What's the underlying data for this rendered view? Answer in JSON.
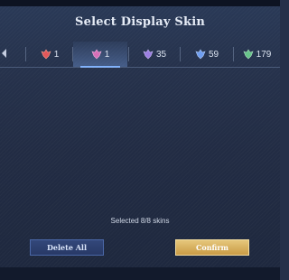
{
  "title": "Select Display Skin",
  "tabs": [
    {
      "count": "1",
      "icon": "red-rank-emblem-icon",
      "color": "#e3575a",
      "selected": false
    },
    {
      "count": "1",
      "icon": "pink-rank-emblem-icon",
      "color": "#d76fb8",
      "selected": true
    },
    {
      "count": "35",
      "icon": "purple-rank-emblem-icon",
      "color": "#9b7fe2",
      "selected": false
    },
    {
      "count": "59",
      "icon": "blue-rank-emblem-icon",
      "color": "#6f9ef0",
      "selected": false
    },
    {
      "count": "179",
      "icon": "green-rank-emblem-icon",
      "color": "#67c58a",
      "selected": false
    }
  ],
  "status": "Selected 8/8 skins",
  "buttons": {
    "delete_all": "Delete All",
    "confirm": "Confirm"
  },
  "colors": {
    "confirm_gold": "#d9b25f",
    "delete_blue": "#2e4173",
    "selected_tab_accent": "#7fb3ff"
  }
}
